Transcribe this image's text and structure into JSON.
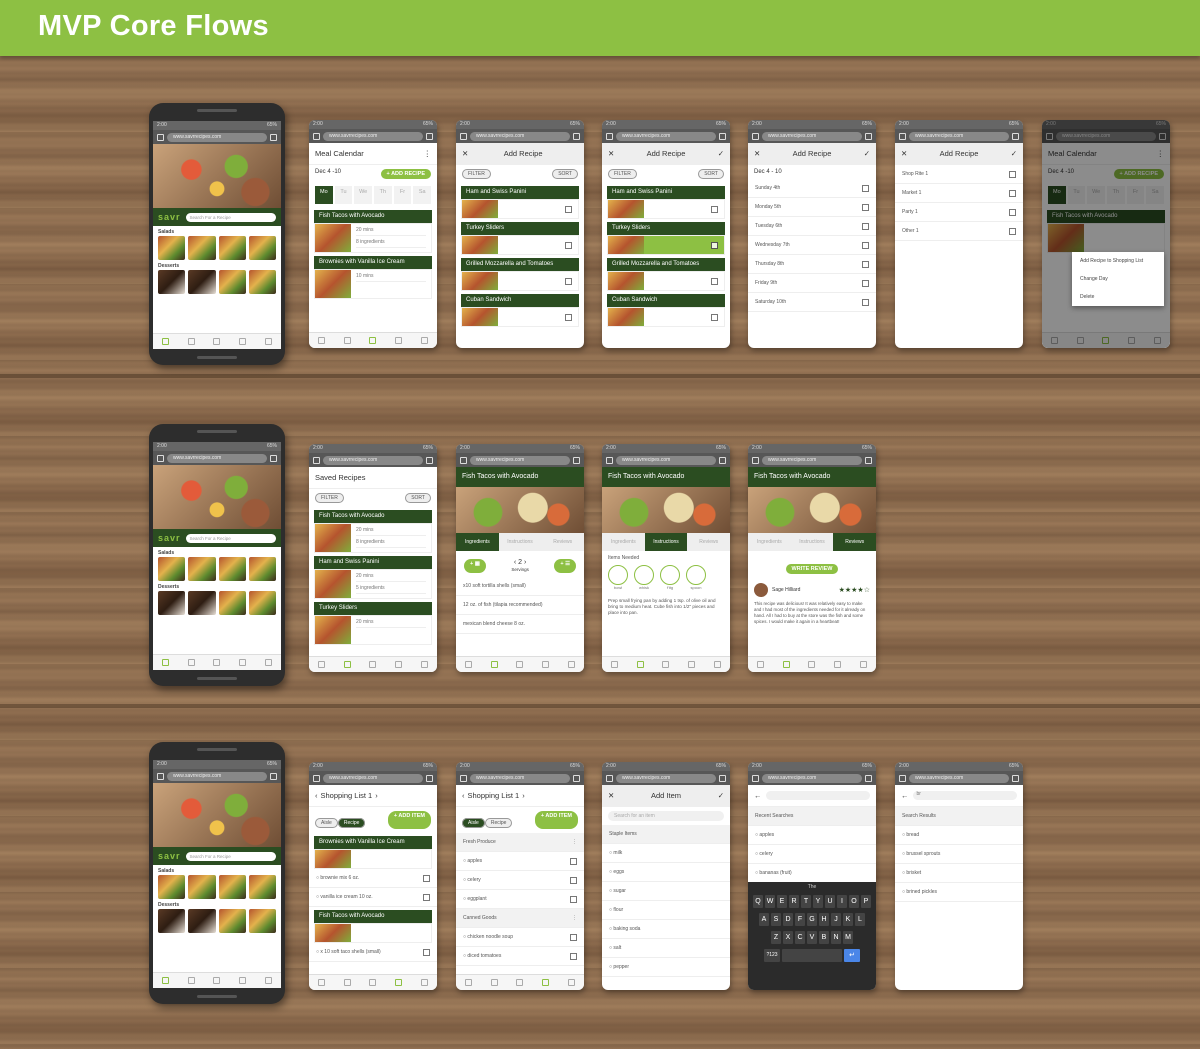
{
  "title": "MVP Core Flows",
  "url": "www.savrrecipes.com",
  "status_time": "2:00",
  "battery": "65%",
  "brand": "savr",
  "search_placeholder": "Search For a Recipe",
  "categories": [
    "Salads",
    "Desserts"
  ],
  "row1": {
    "meal_calendar": {
      "title": "Meal Calendar",
      "range": "Dec 4 -10",
      "add": "+ ADD RECIPE",
      "days": [
        [
          "Mo",
          "4th"
        ],
        [
          "Tu",
          "5th"
        ],
        [
          "We",
          "6th"
        ],
        [
          "Th",
          "7th"
        ],
        [
          "Fr",
          "8th"
        ],
        [
          "Sa",
          "9th"
        ]
      ],
      "items": [
        {
          "name": "Fish Tacos with Avocado",
          "time": "20 mins",
          "ingr": "8 ingredients"
        },
        {
          "name": "Brownies with Vanilla Ice Cream",
          "time": "10 mins"
        }
      ]
    },
    "add_recipe": {
      "title": "Add Recipe",
      "filter": "FILTER",
      "sort": "SORT",
      "recipes": [
        "Ham and Swiss Panini",
        "Turkey Sliders",
        "Grilled Mozzarella and Tomatoes",
        "Cuban Sandwich"
      ]
    },
    "add_recipe_days": {
      "title": "Add Recipe",
      "range": "Dec 4 - 10",
      "days": [
        "Sunday 4th",
        "Monday 5th",
        "Tuesday 6th",
        "Wednesday 7th",
        "Thursday 8th",
        "Friday 9th",
        "Saturday 10th"
      ]
    },
    "add_recipe_lists": {
      "title": "Add Recipe",
      "lists": [
        "Shop Rite 1",
        "Market 1",
        "Party 1",
        "Other 1"
      ]
    },
    "context_menu": {
      "title": "Meal Calendar",
      "range": "Dec 4 -10",
      "add": "+ ADD RECIPE",
      "item": "Fish Tacos with Avocado",
      "options": [
        "Add Recipe to Shopping List",
        "Change Day",
        "Delete"
      ]
    }
  },
  "row2": {
    "saved": {
      "title": "Saved Recipes",
      "filter": "FILTER",
      "sort": "SORT",
      "items": [
        {
          "name": "Fish Tacos with Avocado",
          "time": "20 mins",
          "ingr": "8 ingredients"
        },
        {
          "name": "Ham and Swiss Panini",
          "time": "20 mins",
          "ingr": "5 ingredients"
        },
        {
          "name": "Turkey Sliders",
          "time": "20 mins"
        }
      ]
    },
    "recipe": {
      "title": "Fish Tacos with Avocado",
      "tabs": [
        "Ingredients",
        "Instructions",
        "Reviews"
      ],
      "servings": "2",
      "servings_label": "Servings",
      "ingredients": [
        "x10 soft tortilla shells (small)",
        "12 oz. of fish (tilapia recommended)",
        "mexican blend cheese 8 oz."
      ],
      "items_needed": "Items Needed",
      "tools": [
        "bowl",
        "whisk",
        "f'ttg",
        "spoon"
      ],
      "step": "Prep small frying pan by adding 1 tsp. of olive oil and bring to medium heat. Cube fish into 1/2\" pieces and place into pan.",
      "write_review": "WRITE REVIEW",
      "reviewer": "Sage Hilliard",
      "stars": "★★★★☆",
      "review": "This recipe was delicious! It was relatively easy to make and I had most of the ingredients needed for it already on hand. All I had to buy at the store was the fish and some spices. I would make it again in a heartbeat!"
    }
  },
  "row3": {
    "list1": {
      "title": "Shopping List 1",
      "aisle": "Aisle",
      "recipe": "Recipe",
      "add": "+ ADD ITEM",
      "groups": [
        {
          "name": "Brownies with Vanilla Ice Cream",
          "items": [
            "brownie mix 6 oz.",
            "vanilla ice cream 10 oz."
          ]
        },
        {
          "name": "Fish Tacos with Avocado",
          "items": [
            "x 10 soft taco shells (small)"
          ]
        }
      ]
    },
    "list2": {
      "title": "Shopping List 1",
      "aisle": "Aisle",
      "recipe": "Recipe",
      "add": "+ ADD ITEM",
      "groups": [
        {
          "name": "Fresh Produce",
          "items": [
            "apples",
            "celery",
            "eggplant"
          ]
        },
        {
          "name": "Canned Goods",
          "items": [
            "chicken noodle soup",
            "diced tomatoes"
          ]
        }
      ]
    },
    "add_item": {
      "title": "Add Item",
      "placeholder": "Search for an item",
      "section": "Staple Items",
      "items": [
        "milk",
        "eggs",
        "sugar",
        "flour",
        "baking soda",
        "salt",
        "pepper"
      ]
    },
    "recent": {
      "section": "Recent Searches",
      "items": [
        "apples",
        "celery",
        "bananas (fruit)"
      ],
      "suggest": "The",
      "keys1": "QWERTYUIOP",
      "keys2": "ASDFGHJKL",
      "keys3": "ZXCVBNM",
      "num": "?123"
    },
    "results": {
      "query": "br",
      "section": "Search Results",
      "items": [
        "bread",
        "brussel sprouts",
        "brisket",
        "brined pickles"
      ]
    }
  }
}
